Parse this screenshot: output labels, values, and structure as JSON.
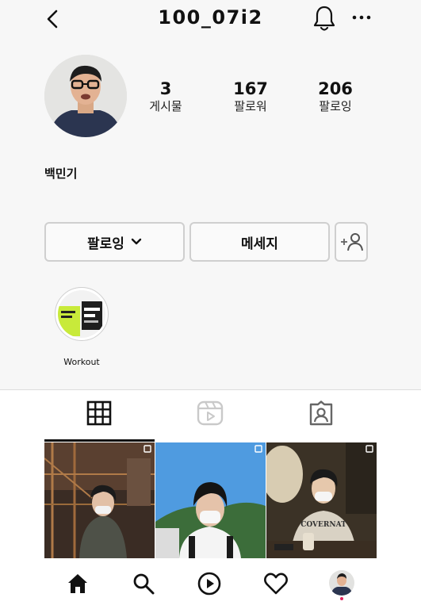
{
  "header": {
    "username": "100_07i2"
  },
  "profile": {
    "display_name": "백민기",
    "stats": [
      {
        "value": "3",
        "label": "게시물"
      },
      {
        "value": "167",
        "label": "팔로워"
      },
      {
        "value": "206",
        "label": "팔로잉"
      }
    ]
  },
  "actions": {
    "following_label": "팔로잉",
    "message_label": "메세지"
  },
  "highlight": {
    "label": "Workout"
  },
  "posts": [
    {
      "caption": ""
    },
    {
      "caption": ""
    },
    {
      "caption": "COVERNAT"
    }
  ],
  "colors": {
    "accent": "#111111",
    "notification_dot": "#e0245e"
  },
  "icons": [
    "back-arrow-icon",
    "bell-icon",
    "more-icon",
    "chevron-down-icon",
    "add-person-icon",
    "grid-icon",
    "reels-icon",
    "tagged-icon",
    "home-icon",
    "search-icon",
    "reels-play-icon",
    "heart-icon"
  ]
}
